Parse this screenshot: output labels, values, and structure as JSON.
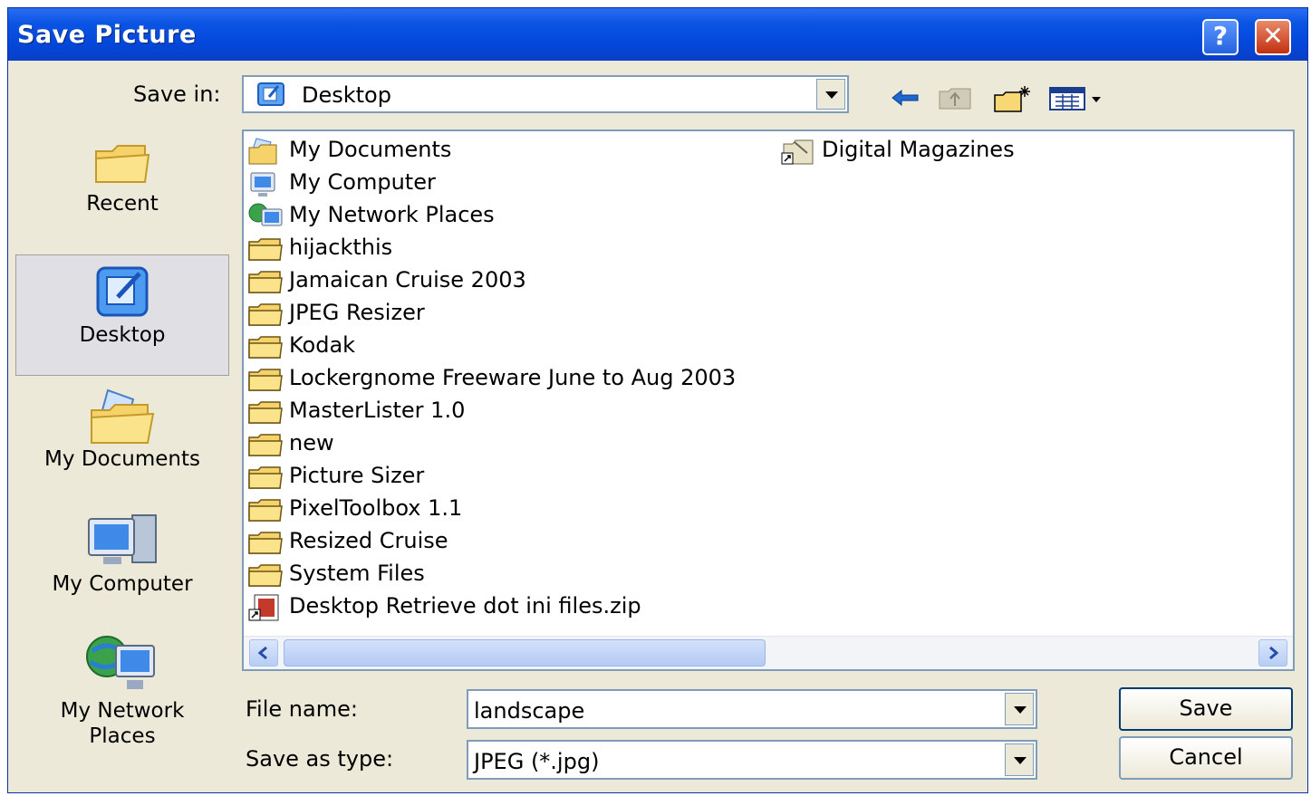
{
  "window": {
    "title": "Save Picture",
    "help_label": "?",
    "close_label": "✕"
  },
  "save_in": {
    "label": "Save in:",
    "value": "Desktop"
  },
  "toolbar_icons": [
    "back-arrow-icon",
    "up-folder-icon",
    "new-folder-icon",
    "view-menu-icon"
  ],
  "places": [
    {
      "label": "Recent",
      "icon": "recent-folder-icon"
    },
    {
      "label": "Desktop",
      "icon": "desktop-icon",
      "selected": true
    },
    {
      "label": "My Documents",
      "icon": "my-documents-icon"
    },
    {
      "label": "My Computer",
      "icon": "my-computer-icon"
    },
    {
      "label": "My Network Places",
      "icon": "network-places-icon"
    }
  ],
  "files": [
    {
      "name": "My Documents",
      "icon": "my-documents-icon"
    },
    {
      "name": "My Computer",
      "icon": "my-computer-icon"
    },
    {
      "name": "My Network Places",
      "icon": "network-places-icon"
    },
    {
      "name": "hijackthis",
      "icon": "folder-icon"
    },
    {
      "name": "Jamaican Cruise 2003",
      "icon": "folder-icon"
    },
    {
      "name": "JPEG Resizer",
      "icon": "folder-icon"
    },
    {
      "name": "Kodak",
      "icon": "folder-icon"
    },
    {
      "name": "Lockergnome Freeware June to Aug 2003",
      "icon": "folder-icon"
    },
    {
      "name": "MasterLister 1.0",
      "icon": "folder-icon"
    },
    {
      "name": "new",
      "icon": "folder-icon"
    },
    {
      "name": "Picture Sizer",
      "icon": "folder-icon"
    },
    {
      "name": "PixelToolbox 1.1",
      "icon": "folder-icon"
    },
    {
      "name": "Resized Cruise",
      "icon": "folder-icon"
    },
    {
      "name": "System Files",
      "icon": "folder-icon"
    },
    {
      "name": "Desktop Retrieve dot ini files.zip",
      "icon": "zip-shortcut-icon"
    },
    {
      "name": "Digital Magazines",
      "icon": "shortcut-icon"
    }
  ],
  "filename": {
    "label": "File name:",
    "value": "landscape"
  },
  "save_as_type": {
    "label": "Save as type:",
    "value": "JPEG (*.jpg)"
  },
  "buttons": {
    "save": "Save",
    "cancel": "Cancel"
  }
}
